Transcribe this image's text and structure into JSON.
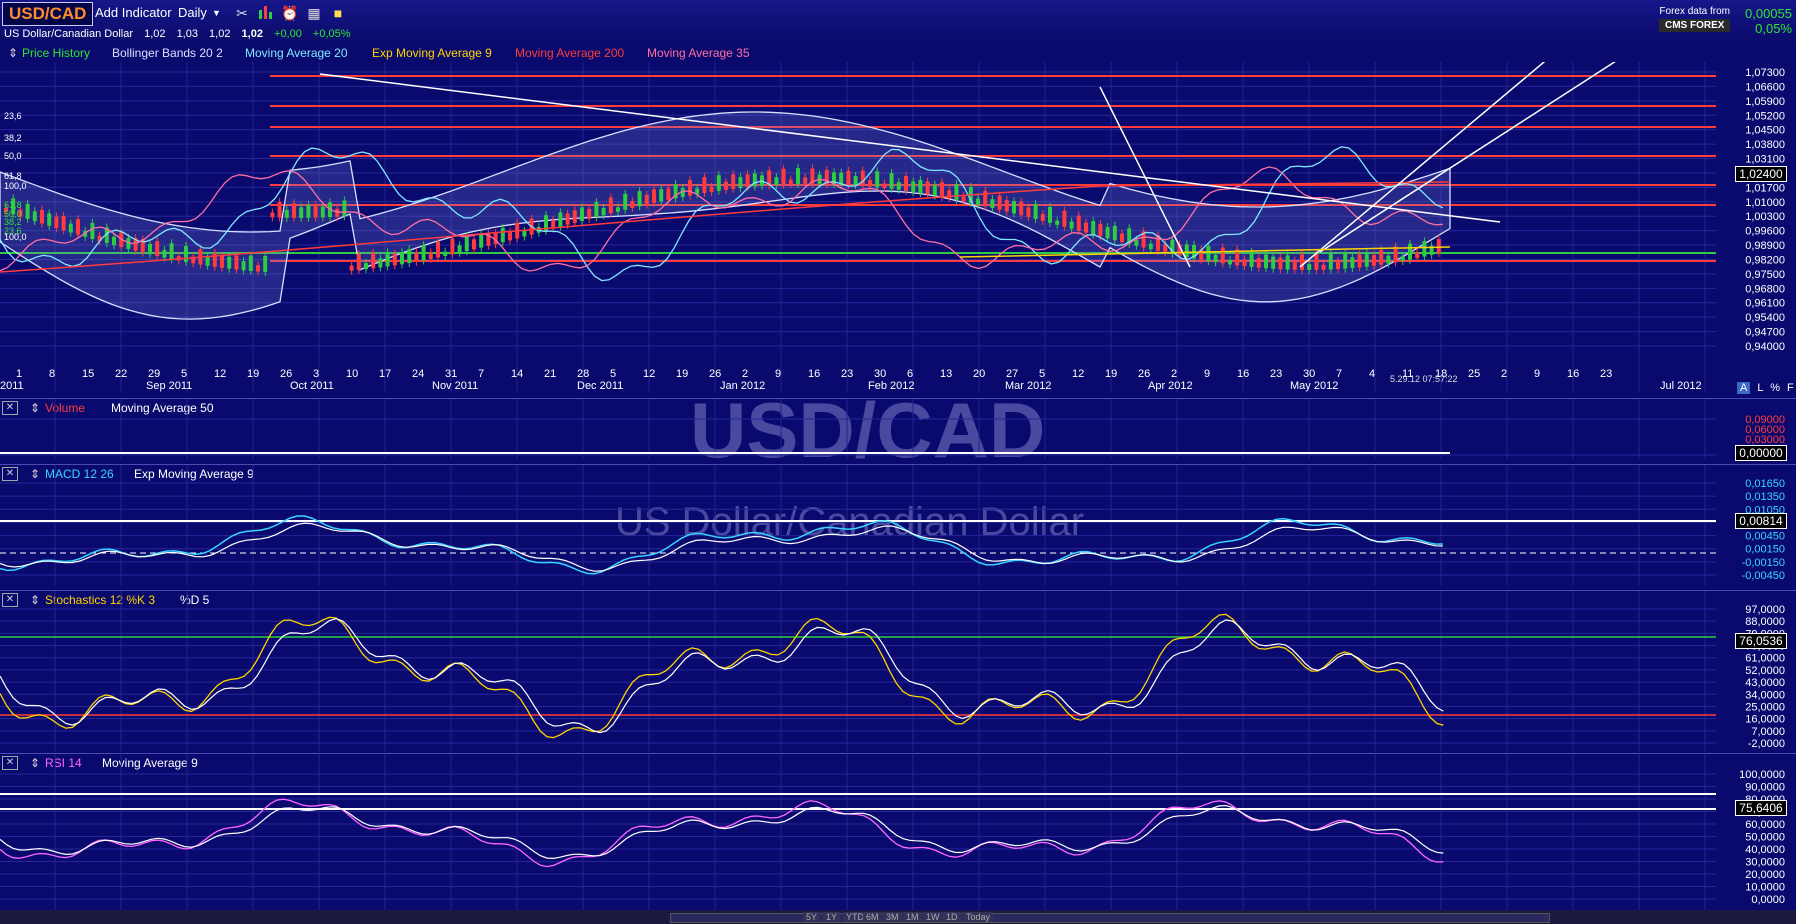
{
  "toolbar": {
    "symbol": "USD/CAD",
    "add_indicator": "Add Indicator",
    "interval": "Daily",
    "forex_label": "Forex data from",
    "forex_brand": "CMS FOREX",
    "change_abs": "0,00055",
    "change_pct": "0,05%"
  },
  "quote": {
    "name": "US Dollar/Canadian Dollar",
    "open": "1,02",
    "high": "1,03",
    "low": "1,02",
    "close": "1,02",
    "change": "+0,00",
    "change_pct": "+0,05%"
  },
  "indicators": [
    "Price History",
    "Bollinger Bands 20 2",
    "Moving Average 20",
    "Exp Moving Average 9",
    "Moving Average 200",
    "Moving Average 35"
  ],
  "colors": {
    "ma200": "#ff3b3b",
    "ma35": "#ff6fa0",
    "bb": "#d8e0ff",
    "ema9": "#ffd400",
    "ma20": "#7fe7ff",
    "green": "#2ecc40",
    "red": "#ff3b3b",
    "pink": "#ff66ff"
  },
  "price_axis": [
    "1,07300",
    "1,06600",
    "1,05900",
    "1,05200",
    "1,04500",
    "1,03800",
    "1,03100",
    "1,02400",
    "1,01700",
    "1,01000",
    "1,00300",
    "0,99600",
    "0,98900",
    "0,98200",
    "0,97500",
    "0,96800",
    "0,96100",
    "0,95400",
    "0,94700",
    "0,94000"
  ],
  "price_last": "1,02400",
  "fib_left": [
    "23,6",
    "38,2",
    "50,0",
    "61,8",
    "100,0",
    "61,8",
    "50,0",
    "38,2",
    "23,6",
    "100,0"
  ],
  "x_ticks": [
    "1",
    "8",
    "15",
    "22",
    "29",
    "5",
    "12",
    "19",
    "26",
    "3",
    "10",
    "17",
    "24",
    "31",
    "7",
    "14",
    "21",
    "28",
    "5",
    "12",
    "19",
    "26",
    "2",
    "9",
    "16",
    "23",
    "30",
    "6",
    "13",
    "20",
    "27",
    "5",
    "12",
    "19",
    "26",
    "2",
    "9",
    "16",
    "23",
    "30",
    "7",
    "4",
    "11",
    "18",
    "25",
    "2",
    "9",
    "16",
    "23"
  ],
  "x_months": [
    "2011",
    "Sep 2011",
    "Oct 2011",
    "Nov 2011",
    "Dec 2011",
    "Jan 2012",
    "Feb 2012",
    "Mar 2012",
    "Apr 2012",
    "May 2012",
    "Jul 2012"
  ],
  "timestamp": "5.29.12 07:57:22",
  "axis_controls": [
    "A",
    "L",
    "%",
    "F"
  ],
  "watermark_symbol": "USD/CAD",
  "watermark_name": "US Dollar/Canadian Dollar",
  "volume": {
    "title": "Volume",
    "ma": "Moving Average 50",
    "axis": [
      "0,09000",
      "0,06000",
      "0,03000"
    ],
    "last": "0,00000"
  },
  "macd": {
    "title": "MACD 12 26",
    "ema": "Exp Moving Average 9",
    "axis": [
      "0,01650",
      "0,01350",
      "0,01050",
      "0,00750",
      "0,00450",
      "0,00150",
      "-0,00150",
      "-0,00450"
    ],
    "last": "0,00814"
  },
  "stoch": {
    "title": "Stochastics 12 %K 3",
    "d": "%D 5",
    "axis": [
      "97,0000",
      "88,0000",
      "79,0000",
      "70,0000",
      "61,0000",
      "52,0000",
      "43,0000",
      "34,0000",
      "25,0000",
      "16,0000",
      "7,0000",
      "-2,0000"
    ],
    "last": "76,0536"
  },
  "rsi": {
    "title": "RSI 14",
    "ma": "Moving Average 9",
    "axis": [
      "100,0000",
      "90,0000",
      "80,0000",
      "70,0000",
      "60,0000",
      "50,0000",
      "40,0000",
      "30,0000",
      "20,0000",
      "10,0000",
      "0,0000"
    ],
    "last": "75,6406"
  },
  "ranges": [
    "5Y",
    "1Y",
    "YTD",
    "6M",
    "3M",
    "1M",
    "1W",
    "1D",
    "Today"
  ]
}
